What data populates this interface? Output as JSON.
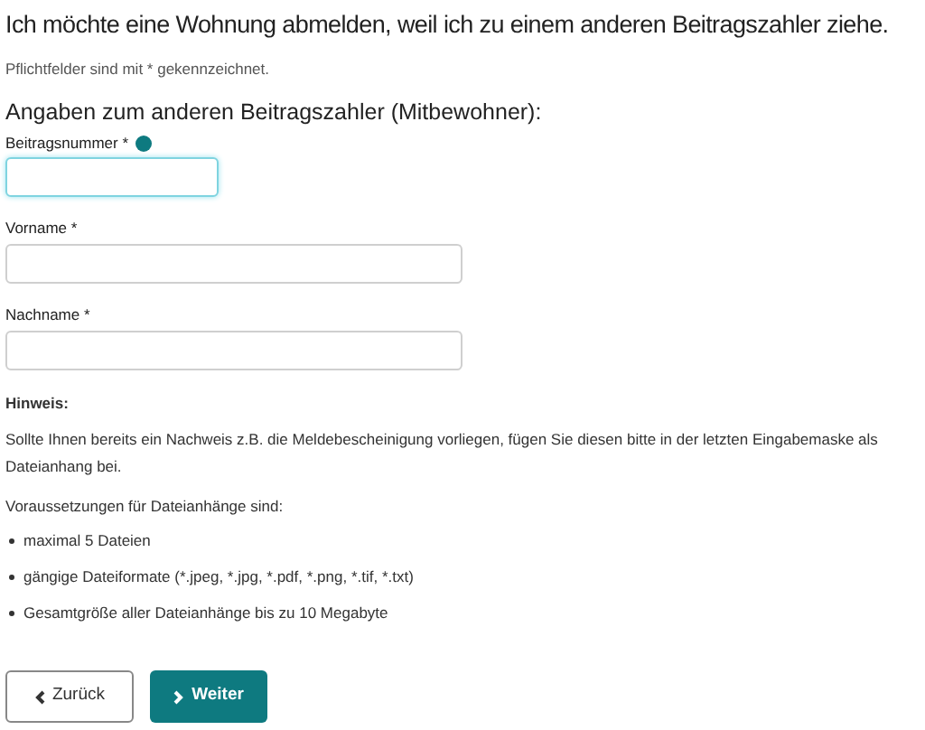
{
  "title": "Ich möchte eine Wohnung abmelden, weil ich zu einem anderen Beitragszahler ziehe.",
  "required_note": "Pflichtfelder sind mit * gekennzeichnet.",
  "section_heading": "Angaben zum anderen Beitragszahler (Mitbewohner):",
  "fields": [
    {
      "label": "Beitragsnummer *",
      "help": true,
      "focused": true
    },
    {
      "label": "Vorname *",
      "help": false,
      "focused": false
    },
    {
      "label": "Nachname *",
      "help": false,
      "focused": false
    }
  ],
  "hint": {
    "heading": "Hinweis:",
    "text": "Sollte Ihnen bereits ein Nachweis z.B. die Meldebescheinigung vorliegen, fügen Sie diesen bitte in der letzten Eingabemaske als Dateianhang bei.",
    "requirements_intro": "Voraussetzungen für Dateianhänge sind:",
    "requirements": [
      "maximal 5 Dateien",
      "gängige Dateiformate (*.jpeg, *.jpg, *.pdf, *.png, *.tif, *.txt)",
      "Gesamtgröße aller Dateianhänge bis zu 10 Megabyte"
    ]
  },
  "buttons": [
    {
      "kind": "back",
      "label": "Zurück"
    },
    {
      "kind": "next",
      "label": "Weiter"
    }
  ]
}
